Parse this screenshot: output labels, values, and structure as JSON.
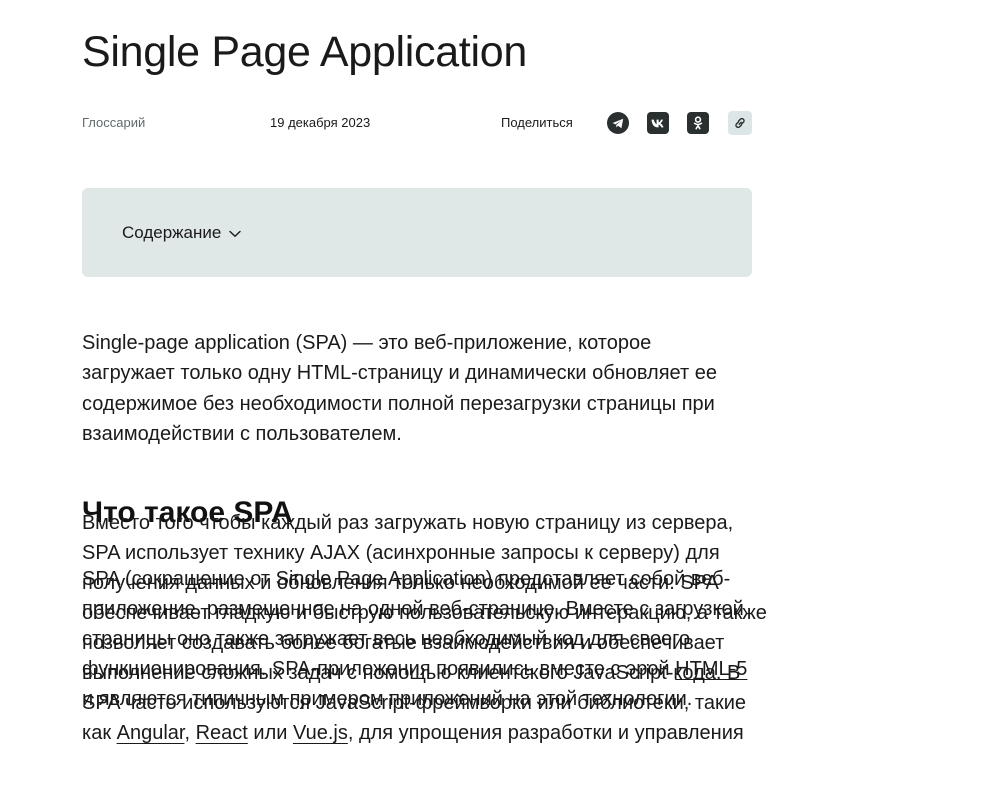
{
  "article": {
    "title": "Single Page Application",
    "category": "Глоссарий",
    "date": "19 декабря 2023",
    "share_label": "Поделиться"
  },
  "share_icons": [
    "telegram-icon",
    "vk-icon",
    "odnoklassniki-icon",
    "link-icon"
  ],
  "toc": {
    "label": "Содержание"
  },
  "lead_paragraph": "Single-page application (SPA) — это веб-приложение, которое загружает только одну HTML-страницу и динамически обновляет ее содержимое без необходимости полной перезагрузки страницы при взаимодействии с пользователем.",
  "section": {
    "heading": "Что такое SPA",
    "paragraph_a_start": "Вместо того чтобы каждый раз загружать новую страницу из сервера, SPA использует технику AJAX (асинхронные запросы к серверу) для получения данных и обновления только необходимой ее части. SPA обеспечивает гладкую и быструю пользовательскую интеракцию, а также позволяет создавать более богатые взаимодействия и обеспечивает выполнение сложных задач с помощью клиентского JavaScript-кода. В SPA часто используются JavaScript-фреймворки или библиотеки, такие как",
    "link_angular": "Angular",
    "link_react": "React",
    "or_word": "или",
    "link_vue": "Vue.js",
    "paragraph_a_end": ", для упрощения разработки и управления",
    "paragraph_b_start": "SPA (сокращение от Single Page Application) представляет собой веб-приложение, размещенное на одной веб-странице. Вместе с загрузкой страницы оно также загружает весь необходимый код для своего функционирования. SPA-приложения появились вместе с эрой",
    "link_html5": "HTML-5",
    "paragraph_b_end": "и являются типичным примером приложений на этой технологии."
  },
  "colors": {
    "toc_background": "#dfe7e7",
    "link_button_background": "#dde6e6",
    "icon_dark": "#2a2f2f",
    "text": "#1a1a1a",
    "muted_text": "#5f6b6b"
  }
}
